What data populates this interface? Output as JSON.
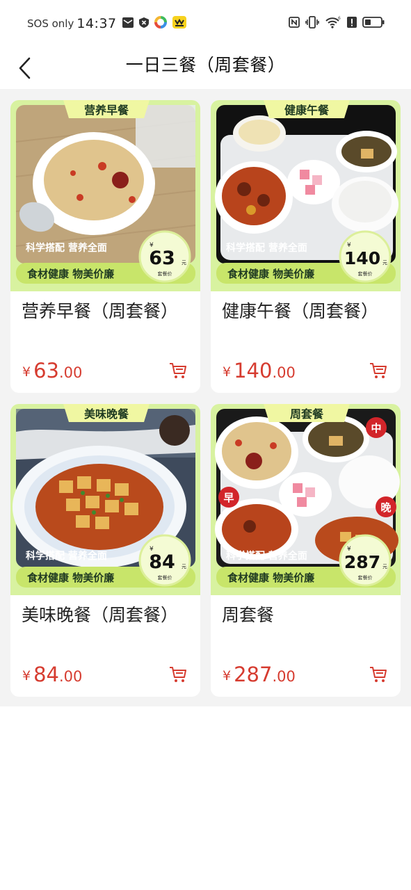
{
  "status_bar": {
    "carrier": "SOS only",
    "time": "14:37",
    "icons": [
      "mail-icon",
      "vpn-icon",
      "colorful-app-icon",
      "yellow-app-icon",
      "nfc-icon",
      "vibrate-icon",
      "wifi-icon",
      "alert-icon",
      "battery-icon"
    ]
  },
  "header": {
    "back_icon": "chevron-left-icon",
    "title": "一日三餐（周套餐）"
  },
  "accent_color": "#d63c30",
  "products": [
    {
      "banner": "营养早餐",
      "slogan1": "科学搭配 营养全面",
      "slogan2": "食材健康 物美价廉",
      "badge_currency": "¥",
      "badge_price": "63",
      "badge_unit": "元",
      "badge_label": "套餐价",
      "name": "营养早餐（周套餐）",
      "currency": "¥",
      "price_int": "63",
      "price_dec": ".00",
      "cart_icon": "cart-icon"
    },
    {
      "banner": "健康午餐",
      "slogan1": "科学搭配 营养全面",
      "slogan2": "食材健康 物美价廉",
      "badge_currency": "¥",
      "badge_price": "140",
      "badge_unit": "元",
      "badge_label": "套餐价",
      "name": "健康午餐（周套餐）",
      "currency": "¥",
      "price_int": "140",
      "price_dec": ".00",
      "cart_icon": "cart-icon"
    },
    {
      "banner": "美味晚餐",
      "slogan1": "科学搭配 营养全面",
      "slogan2": "食材健康 物美价廉",
      "badge_currency": "¥",
      "badge_price": "84",
      "badge_unit": "元",
      "badge_label": "套餐价",
      "name": "美味晚餐（周套餐）",
      "currency": "¥",
      "price_int": "84",
      "price_dec": ".00",
      "cart_icon": "cart-icon"
    },
    {
      "banner": "周套餐",
      "slogan1": "科学搭配 营养全面",
      "slogan2": "食材健康 物美价廉",
      "badge_currency": "¥",
      "badge_price": "287",
      "badge_unit": "元",
      "badge_label": "套餐价",
      "meal_tags": [
        "中",
        "早",
        "晚"
      ],
      "name": "周套餐",
      "currency": "¥",
      "price_int": "287",
      "price_dec": ".00",
      "cart_icon": "cart-icon"
    }
  ]
}
